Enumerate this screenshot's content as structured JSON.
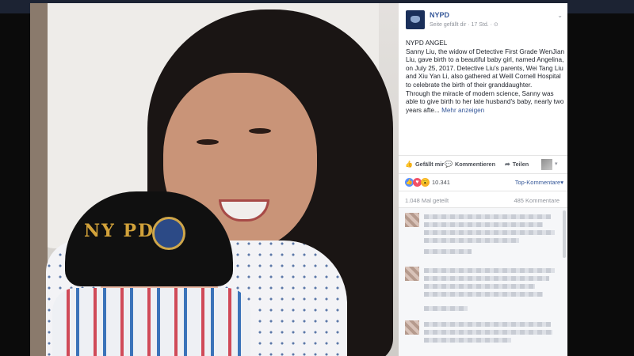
{
  "post": {
    "page_name": "NYPD",
    "meta": "Seite gefällt dir · 17 Std. · ⊙",
    "text_lines": [
      "NYPD ANGEL",
      "Sanny Liu, the widow of Detective First Grade WenJian Liu, gave birth to a beautiful baby girl, named Angelina, on July 25, 2017. Detective Liu's parents, Wei Tang Liu and Xiu Yan Li, also gathered at Weill Cornell Hospital to celebrate the birth of their granddaughter.",
      "Through the miracle of modern science, Sanny was able to give birth to her late husband's baby, nearly two years afte..."
    ],
    "more_label": "Mehr anzeigen"
  },
  "actions": {
    "like": "Gefällt mir",
    "comment": "Kommentieren",
    "share": "Teilen"
  },
  "reactions": {
    "count": "10.341",
    "sort_label": "Top-Kommentare"
  },
  "stats": {
    "shares": "1.048 Mal geteilt",
    "comments": "485 Kommentare"
  },
  "photo": {
    "hat_text": "NY  PD"
  },
  "colors": {
    "link": "#365899",
    "like": "#5890ff",
    "love": "#f25268",
    "wow": "#f7b125"
  },
  "icons": {
    "like": "thumbs-up-icon",
    "comment": "speech-bubble-icon",
    "share": "share-arrow-icon",
    "options": "chevron-down-icon"
  }
}
